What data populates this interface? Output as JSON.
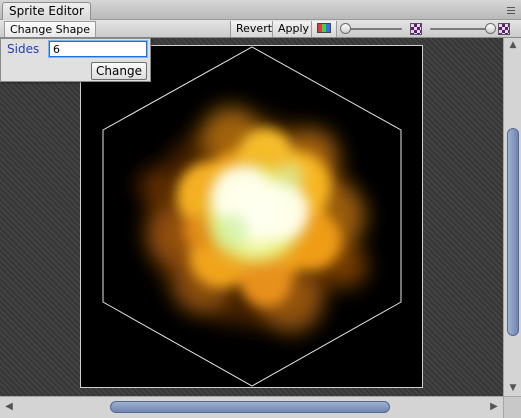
{
  "window": {
    "title": "Sprite Editor"
  },
  "toolbar": {
    "tab_label": "Change Shape",
    "revert_label": "Revert",
    "apply_label": "Apply",
    "color_channels_icon": "rgb-channels-icon",
    "alpha_icon": "alpha-checker-icon",
    "mip_icon": "mip-checker-icon",
    "zoom_slider_value": 0.0,
    "mip_slider_value": 1.0
  },
  "popup": {
    "sides_label": "Sides",
    "sides_value": "6",
    "change_label": "Change"
  },
  "colors": {
    "accent": "#1e3fb8",
    "input_focus": "#1f6fd6",
    "scroll_thumb": "#7f93bd",
    "sprite_background": "#000000",
    "outline": "#e6e6e6"
  },
  "scroll": {
    "vertical_icon_up": "arrow-up-icon",
    "vertical_icon_down": "arrow-down-icon",
    "horizontal_icon_left": "arrow-left-icon",
    "horizontal_icon_right": "arrow-right-icon"
  }
}
